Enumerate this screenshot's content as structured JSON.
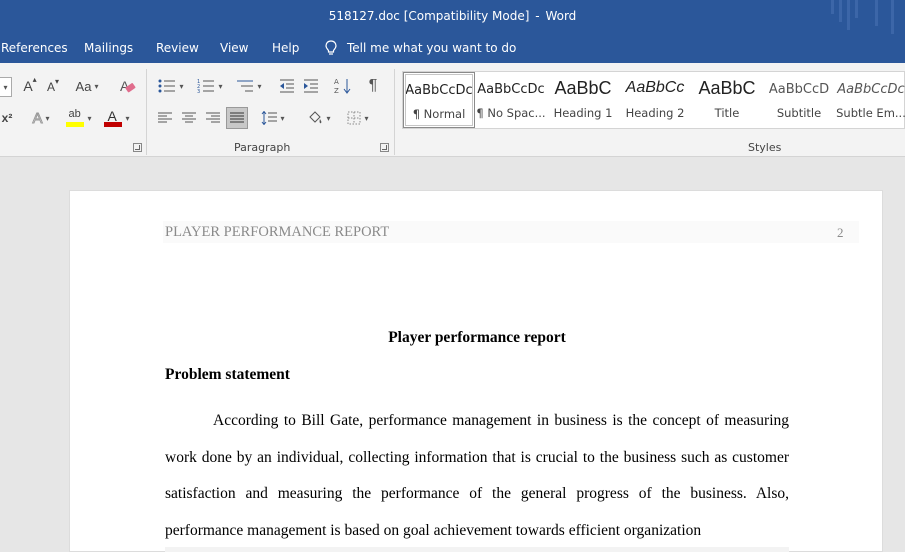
{
  "window": {
    "title_file": "518127.doc [Compatibility Mode]",
    "title_sep": "-",
    "title_app": "Word",
    "accent_color": "#2b579a"
  },
  "tabs": [
    "References",
    "Mailings",
    "Review",
    "View",
    "Help"
  ],
  "tell_me": {
    "icon": "lightbulb-icon",
    "placeholder": "Tell me what you want to do"
  },
  "ribbon": {
    "font_group": {
      "grow_font": "A",
      "shrink_font": "A",
      "change_case": "Aa",
      "clear_formatting_icon": "eraser-icon",
      "superscript": "x²",
      "text_effects": "A",
      "highlight": "ab",
      "font_color": "A",
      "highlight_color": "#ffff00",
      "font_color_value": "#c00000"
    },
    "paragraph_group": {
      "label": "Paragraph",
      "show_hide": "¶"
    },
    "styles_group": {
      "label": "Styles",
      "items": [
        {
          "sample": "AaBbCcDc",
          "name": "¶ Normal"
        },
        {
          "sample": "AaBbCcDc",
          "name": "¶ No Spac..."
        },
        {
          "sample": "AaBbC",
          "name": "Heading 1"
        },
        {
          "sample": "AaBbCc",
          "name": "Heading 2"
        },
        {
          "sample": "AaBbC",
          "name": "Title"
        },
        {
          "sample": "AaBbCcD",
          "name": "Subtitle"
        },
        {
          "sample": "AaBbCcDc",
          "name": "Subtle Em..."
        }
      ]
    }
  },
  "document": {
    "header": "PLAYER PERFORMANCE REPORT",
    "page_number": "2",
    "title": "Player performance report",
    "heading": "Problem statement",
    "paragraph": "According to Bill Gate, performance management in business is the concept of measuring work done by an individual, collecting information that is crucial to the business such as customer satisfaction and measuring the performance of the general progress of the business. Also, performance management is based on goal achievement towards efficient organization"
  }
}
